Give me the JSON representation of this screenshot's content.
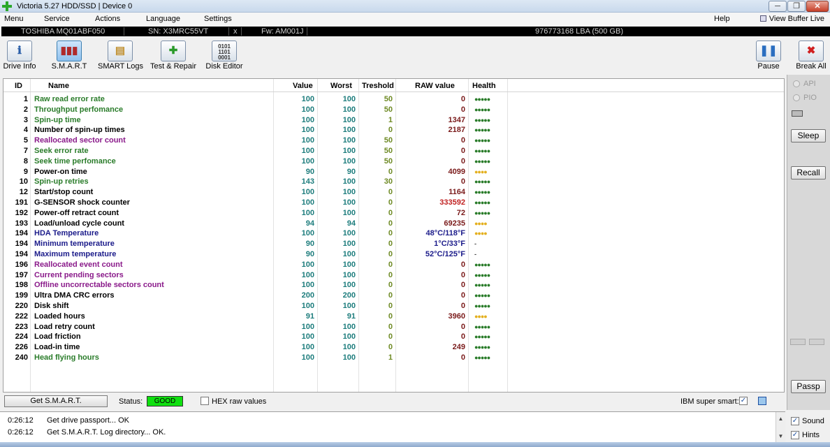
{
  "window": {
    "title": "Victoria 5.27 HDD/SSD | Device 0",
    "min_glyph": "─",
    "max_glyph": "❐",
    "close_glyph": "✕"
  },
  "menu": {
    "items": [
      "Menu",
      "Service",
      "Actions",
      "Language",
      "Settings"
    ],
    "help": "Help",
    "view_buffer": "View Buffer Live"
  },
  "drive": {
    "model": "TOSHIBA MQ01ABF050",
    "serial": "SN: X3MRC55VT",
    "close_glyph": "x",
    "firmware": "Fw: AM001J",
    "capacity": "976773168 LBA (500 GB)"
  },
  "toolbar": {
    "drive_info": "Drive Info",
    "smart": "S.M.A.R.T",
    "smart_logs": "SMART Logs",
    "test_repair": "Test & Repair",
    "disk_editor": "Disk Editor",
    "pause": "Pause",
    "break_all": "Break All"
  },
  "table": {
    "headers": {
      "id": "ID",
      "name": "Name",
      "value": "Value",
      "worst": "Worst",
      "threshold": "Treshold",
      "raw": "RAW value",
      "health": "Health"
    },
    "rows": [
      {
        "id": "1",
        "name": "Raw read error rate",
        "value": "100",
        "worst": "100",
        "threshold": "50",
        "raw": "0",
        "health": "●●●●●"
      },
      {
        "id": "2",
        "name": "Throughput perfomance",
        "value": "100",
        "worst": "100",
        "threshold": "50",
        "raw": "0",
        "health": "●●●●●"
      },
      {
        "id": "3",
        "name": "Spin-up time",
        "value": "100",
        "worst": "100",
        "threshold": "1",
        "raw": "1347",
        "health": "●●●●●"
      },
      {
        "id": "4",
        "name": "Number of spin-up times",
        "value": "100",
        "worst": "100",
        "threshold": "0",
        "raw": "2187",
        "health": "●●●●●"
      },
      {
        "id": "5",
        "name": "Reallocated sector count",
        "value": "100",
        "worst": "100",
        "threshold": "50",
        "raw": "0",
        "health": "●●●●●"
      },
      {
        "id": "7",
        "name": "Seek error rate",
        "value": "100",
        "worst": "100",
        "threshold": "50",
        "raw": "0",
        "health": "●●●●●"
      },
      {
        "id": "8",
        "name": "Seek time perfomance",
        "value": "100",
        "worst": "100",
        "threshold": "50",
        "raw": "0",
        "health": "●●●●●"
      },
      {
        "id": "9",
        "name": "Power-on time",
        "value": "90",
        "worst": "90",
        "threshold": "0",
        "raw": "4099",
        "health": "●●●●"
      },
      {
        "id": "10",
        "name": "Spin-up retries",
        "value": "143",
        "worst": "100",
        "threshold": "30",
        "raw": "0",
        "health": "●●●●●"
      },
      {
        "id": "12",
        "name": "Start/stop count",
        "value": "100",
        "worst": "100",
        "threshold": "0",
        "raw": "1164",
        "health": "●●●●●"
      },
      {
        "id": "191",
        "name": "G-SENSOR shock counter",
        "value": "100",
        "worst": "100",
        "threshold": "0",
        "raw": "333592",
        "health": "●●●●●"
      },
      {
        "id": "192",
        "name": "Power-off retract count",
        "value": "100",
        "worst": "100",
        "threshold": "0",
        "raw": "72",
        "health": "●●●●●"
      },
      {
        "id": "193",
        "name": "Load/unload cycle count",
        "value": "94",
        "worst": "94",
        "threshold": "0",
        "raw": "69235",
        "health": "●●●●"
      },
      {
        "id": "194",
        "name": "HDA Temperature",
        "value": "100",
        "worst": "100",
        "threshold": "0",
        "raw": "48°C/118°F",
        "health": "●●●●"
      },
      {
        "id": "194",
        "name": "Minimum temperature",
        "value": "90",
        "worst": "100",
        "threshold": "0",
        "raw": "1°C/33°F",
        "health": "-"
      },
      {
        "id": "194",
        "name": "Maximum temperature",
        "value": "90",
        "worst": "100",
        "threshold": "0",
        "raw": "52°C/125°F",
        "health": "-"
      },
      {
        "id": "196",
        "name": "Reallocated event count",
        "value": "100",
        "worst": "100",
        "threshold": "0",
        "raw": "0",
        "health": "●●●●●"
      },
      {
        "id": "197",
        "name": "Current pending sectors",
        "value": "100",
        "worst": "100",
        "threshold": "0",
        "raw": "0",
        "health": "●●●●●"
      },
      {
        "id": "198",
        "name": "Offline uncorrectable sectors count",
        "value": "100",
        "worst": "100",
        "threshold": "0",
        "raw": "0",
        "health": "●●●●●"
      },
      {
        "id": "199",
        "name": "Ultra DMA CRC errors",
        "value": "200",
        "worst": "200",
        "threshold": "0",
        "raw": "0",
        "health": "●●●●●"
      },
      {
        "id": "220",
        "name": "Disk shift",
        "value": "100",
        "worst": "100",
        "threshold": "0",
        "raw": "0",
        "health": "●●●●●"
      },
      {
        "id": "222",
        "name": "Loaded hours",
        "value": "91",
        "worst": "91",
        "threshold": "0",
        "raw": "3960",
        "health": "●●●●"
      },
      {
        "id": "223",
        "name": "Load retry count",
        "value": "100",
        "worst": "100",
        "threshold": "0",
        "raw": "0",
        "health": "●●●●●"
      },
      {
        "id": "224",
        "name": "Load friction",
        "value": "100",
        "worst": "100",
        "threshold": "0",
        "raw": "0",
        "health": "●●●●●"
      },
      {
        "id": "226",
        "name": "Load-in time",
        "value": "100",
        "worst": "100",
        "threshold": "0",
        "raw": "249",
        "health": "●●●●●"
      },
      {
        "id": "240",
        "name": "Head flying hours",
        "value": "100",
        "worst": "100",
        "threshold": "1",
        "raw": "0",
        "health": "●●●●●"
      }
    ]
  },
  "statusbar": {
    "get_smart": "Get S.M.A.R.T.",
    "status_label": "Status:",
    "status_value": "GOOD",
    "hex_label": "HEX raw values",
    "ibm_label": "IBM super smart:",
    "ibm_checked": "✓"
  },
  "side": {
    "api": "API",
    "pio": "PIO",
    "sleep": "Sleep",
    "recall": "Recall",
    "passp": "Passp"
  },
  "log": {
    "lines": [
      {
        "time": "0:26:12",
        "text": "Get drive passport... OK"
      },
      {
        "time": "0:26:12",
        "text": "Get S.M.A.R.T. Log directory... OK."
      }
    ],
    "sound": "Sound",
    "hints": "Hints",
    "check": "✓"
  },
  "colors": {
    "status_good": "#0fe00f",
    "name_green": "#2a7c2a",
    "name_purple": "#8a1a8a",
    "name_navy": "#1b1b8a",
    "health_yellow": "#e4b020"
  }
}
